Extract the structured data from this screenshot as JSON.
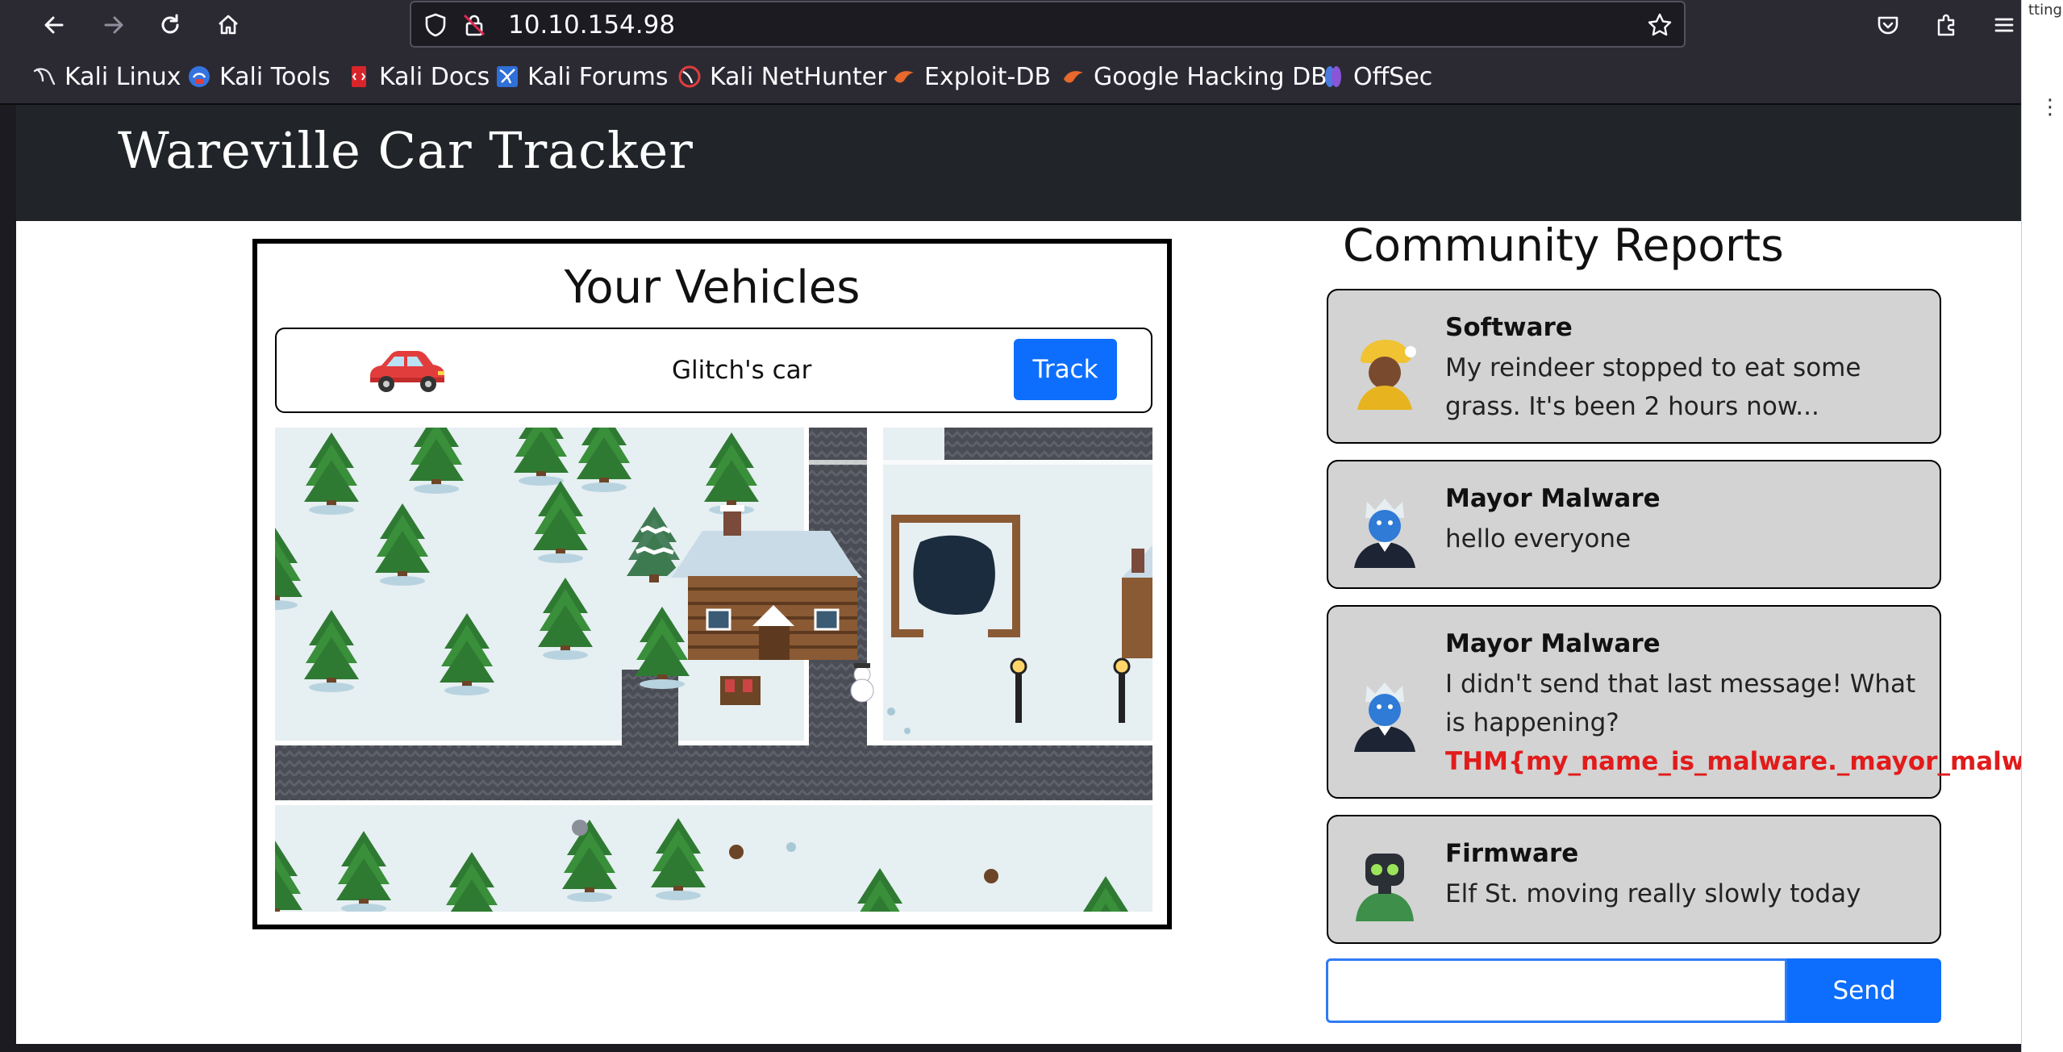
{
  "browser": {
    "url": "10.10.154.98",
    "bookmarks": [
      "Kali Linux",
      "Kali Tools",
      "Kali Docs",
      "Kali Forums",
      "Kali NetHunter",
      "Exploit-DB",
      "Google Hacking DB",
      "OffSec"
    ]
  },
  "side_window": {
    "text": "tting",
    "dots": "⋮"
  },
  "site": {
    "title": "Wareville Car Tracker"
  },
  "vehicles": {
    "title": "Your Vehicles",
    "car_name": "Glitch's car",
    "track_label": "Track"
  },
  "reports": {
    "title": "Community Reports",
    "items": [
      {
        "author": "Software",
        "message": "My reindeer stopped to eat some grass. It's been 2 hours now..."
      },
      {
        "author": "Mayor Malware",
        "message": "hello everyone"
      },
      {
        "author": "Mayor Malware",
        "message": "I didn't send that last message! What is happening?",
        "flag": "THM{my_name_is_malware._mayor_malware}"
      },
      {
        "author": "Firmware",
        "message": "Elf St. moving really slowly today"
      }
    ]
  },
  "composer": {
    "send_label": "Send"
  },
  "colors": {
    "accent": "#0d6efd",
    "header_bg": "#212529",
    "card_bg": "#d3d3d3",
    "flag": "#e21b1b"
  }
}
